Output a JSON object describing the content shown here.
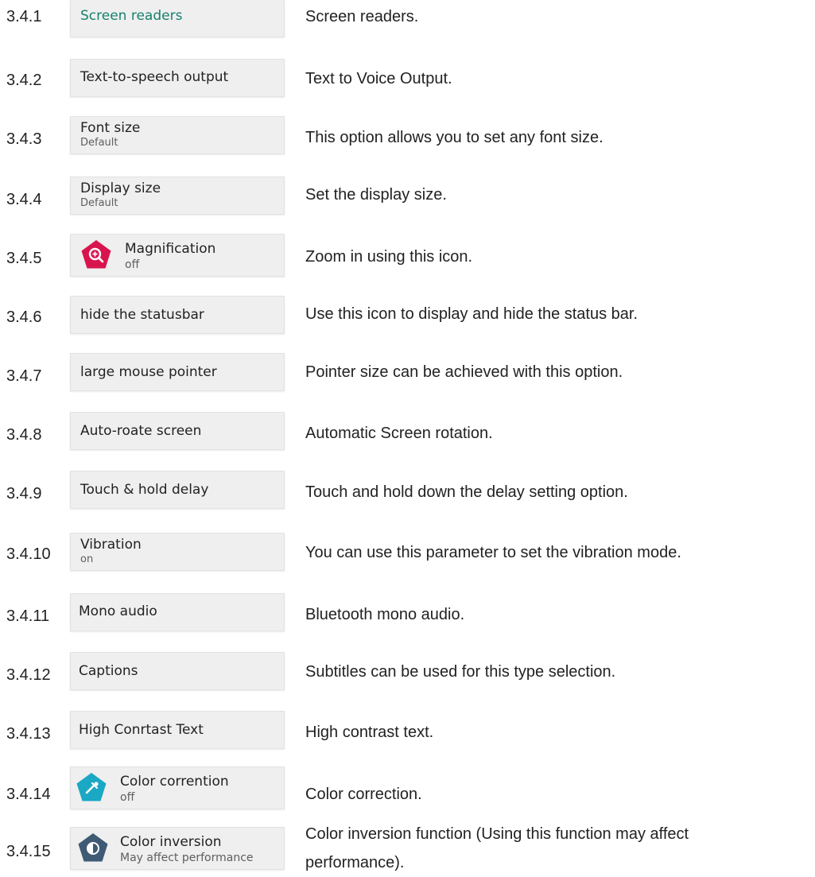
{
  "colors": {
    "accent_teal": "#16826e",
    "magnification_icon": "#d8144f",
    "color_correction_icon": "#1aa8c4",
    "color_inversion_icon": "#3f5a74"
  },
  "items": [
    {
      "num": "3.4.1",
      "title": "Screen readers",
      "desc": "Screen readers."
    },
    {
      "num": "3.4.2",
      "title": "Text-to-speech output",
      "desc": "Text to Voice Output."
    },
    {
      "num": "3.4.3",
      "title": "Font size",
      "sub": "Default",
      "desc": "This option allows you to set any font size."
    },
    {
      "num": "3.4.4",
      "title": "Display size",
      "sub": "Default",
      "desc": "Set the display size."
    },
    {
      "num": "3.4.5",
      "title": "Magnification",
      "sub": "off",
      "icon": "magnify-plus-icon",
      "desc": "Zoom in using this icon."
    },
    {
      "num": "3.4.6",
      "title": "hide the statusbar",
      "desc": "Use this icon to display and hide the status bar."
    },
    {
      "num": "3.4.7",
      "title": "large mouse pointer",
      "desc": "Pointer size can be achieved with this option."
    },
    {
      "num": "3.4.8",
      "title": "Auto-roate screen",
      "desc": "Automatic Screen rotation."
    },
    {
      "num": "3.4.9",
      "title": "Touch & hold delay",
      "desc": "Touch and hold down the delay setting option."
    },
    {
      "num": "3.4.10",
      "title": "Vibration",
      "sub": "on",
      "desc": "You can use this parameter to set the vibration mode."
    },
    {
      "num": "3.4.11",
      "title": "Mono audio",
      "desc": "Bluetooth mono audio."
    },
    {
      "num": "3.4.12",
      "title": "Captions",
      "desc": "Subtitles can be used for this type selection."
    },
    {
      "num": "3.4.13",
      "title": "High Conrtast Text",
      "desc": "High contrast text."
    },
    {
      "num": "3.4.14",
      "title": "Color corrention",
      "sub": "off",
      "icon": "eyedropper-icon",
      "desc": "Color correction."
    },
    {
      "num": "3.4.15",
      "title": "Color inversion",
      "sub": "May affect performance",
      "icon": "contrast-icon",
      "desc": "Color inversion function (Using this function may affect",
      "desc2": "performance)."
    }
  ]
}
